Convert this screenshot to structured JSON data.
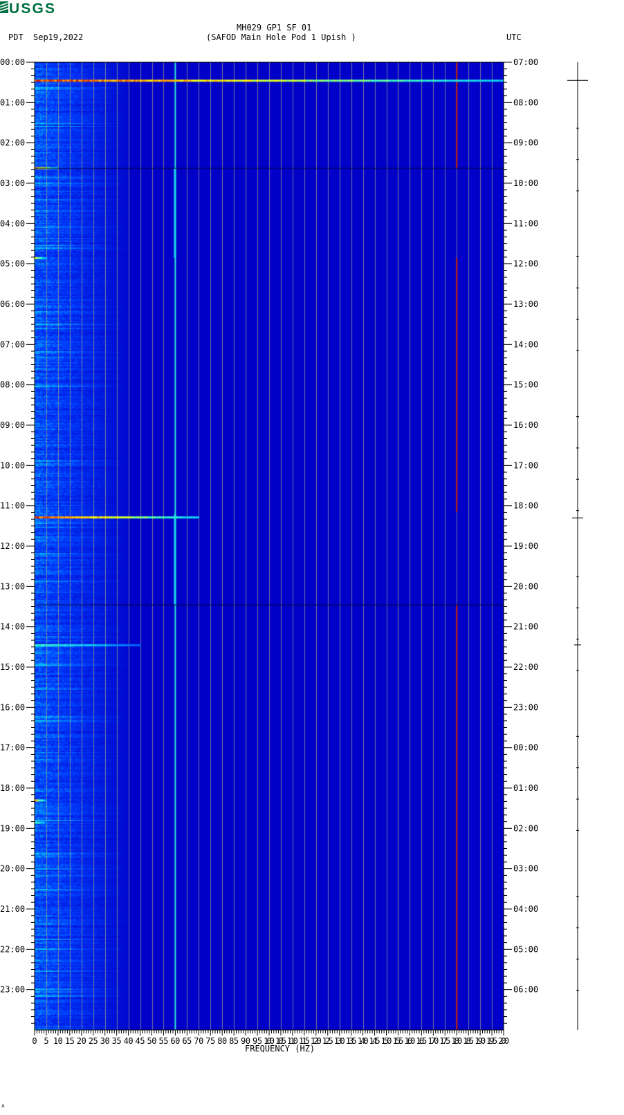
{
  "logo": {
    "text": "USGS",
    "color": "#006f41"
  },
  "header": {
    "title": "MH029 GP1 SF 01",
    "subtitle": "(SAFOD Main Hole Pod 1 Upish )",
    "left_tz": "PDT",
    "date": "Sep19,2022",
    "right_tz": "UTC"
  },
  "footer_mark": "ᴧ",
  "chart_data": {
    "type": "heatmap",
    "title": "MH029 GP1 SF 01 (SAFOD Main Hole Pod 1 Upish )",
    "xlabel": "FREQUENCY (HZ)",
    "xlim": [
      0,
      200
    ],
    "x_ticks": [
      "0",
      "5",
      "10",
      "15",
      "20",
      "25",
      "30",
      "35",
      "40",
      "45",
      "50",
      "55",
      "60",
      "65",
      "70",
      "75",
      "80",
      "85",
      "90",
      "95",
      "100",
      "105",
      "110",
      "115",
      "120",
      "125",
      "130",
      "135",
      "140",
      "145",
      "150",
      "155",
      "160",
      "165",
      "170",
      "175",
      "180",
      "185",
      "190",
      "195",
      "200"
    ],
    "ylim_hours": [
      0,
      24
    ],
    "y_ticks_left": [
      "00:00",
      "01:00",
      "02:00",
      "03:00",
      "04:00",
      "05:00",
      "06:00",
      "07:00",
      "08:00",
      "09:00",
      "10:00",
      "11:00",
      "12:00",
      "13:00",
      "14:00",
      "15:00",
      "16:00",
      "17:00",
      "18:00",
      "19:00",
      "20:00",
      "21:00",
      "22:00",
      "23:00"
    ],
    "y_ticks_right": [
      "07:00",
      "08:00",
      "09:00",
      "10:00",
      "11:00",
      "12:00",
      "13:00",
      "14:00",
      "15:00",
      "16:00",
      "17:00",
      "18:00",
      "19:00",
      "20:00",
      "21:00",
      "22:00",
      "23:00",
      "00:00",
      "01:00",
      "02:00",
      "03:00",
      "04:00",
      "05:00",
      "06:00"
    ],
    "colormap": [
      "#0000c8",
      "#0040ff",
      "#00c0ff",
      "#40ffc0",
      "#ffff00",
      "#ff8000",
      "#c00000"
    ],
    "background_energy_band_hz": [
      0,
      40
    ],
    "tonal_lines_hz": [
      {
        "freq": 60,
        "segments_hours": [
          [
            0,
            24
          ]
        ],
        "level": 0.45
      },
      {
        "freq": 180,
        "segments_hours": [
          [
            0,
            2.62
          ],
          [
            4.85,
            11.15
          ],
          [
            13.45,
            24
          ]
        ],
        "level": 0.95
      }
    ],
    "events": [
      {
        "time_hours": 0.45,
        "max_freq_hz": 200,
        "level": 1.0
      },
      {
        "time_hours": 2.62,
        "max_freq_hz": 10,
        "level": 0.9
      },
      {
        "time_hours": 4.85,
        "max_freq_hz": 5,
        "level": 0.7
      },
      {
        "time_hours": 11.28,
        "max_freq_hz": 70,
        "level": 1.0
      },
      {
        "time_hours": 14.45,
        "max_freq_hz": 45,
        "level": 0.55
      },
      {
        "time_hours": 18.3,
        "max_freq_hz": 5,
        "level": 0.8
      },
      {
        "time_hours": 18.85,
        "max_freq_hz": 5,
        "level": 0.6
      }
    ],
    "data_gaps_hours": [
      2.62,
      13.45
    ],
    "trace_events_hours": [
      0.45,
      11.3,
      14.45
    ]
  }
}
